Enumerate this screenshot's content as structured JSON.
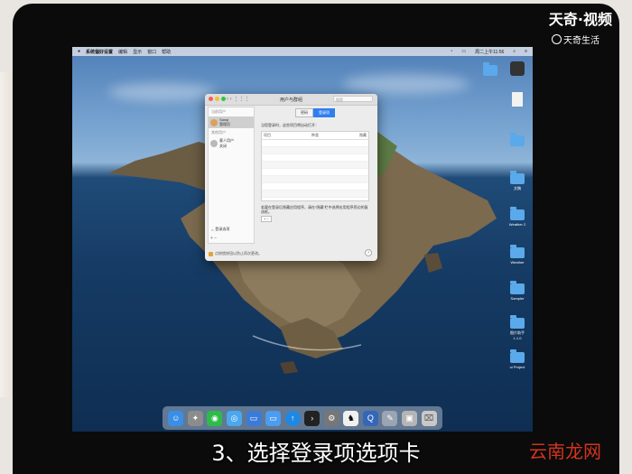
{
  "menubar": {
    "apple": "",
    "app": "系统偏好设置",
    "items": [
      "编辑",
      "显示",
      "窗口",
      "帮助"
    ],
    "clock": "周二上午11:56"
  },
  "desktop_icons": [
    "",
    "",
    "",
    "文稿",
    "Weather 2",
    "Weather",
    "Sampler",
    "图片助手1.1.0",
    "ui Project"
  ],
  "window": {
    "title": "用户与群组",
    "nav": "‹ › ⋮⋮⋮",
    "search_placeholder": "搜索",
    "sidebar": {
      "header_current": "当前用户",
      "user_name": "Sanqi",
      "user_role": "管理员",
      "header_other": "其他用户",
      "guest_name": "客人用户",
      "guest_status": "关闭",
      "login_options": "登录选项",
      "add_remove": "+ −"
    },
    "tabs": [
      "密码",
      "登录项"
    ],
    "active_tab": 1,
    "hint": "当您登录时，这些项目将自动打开：",
    "table_headers": [
      "项目",
      "种类",
      "隐藏"
    ],
    "note": "若要在登录后隐藏应用程序，请在“隐藏”栏中选择应用程序旁边的复选框。",
    "plusminus": "+ −",
    "lock_text": "点按锁按钮以防止再次更改。",
    "help": "?"
  },
  "subtitle": "3、选择登录项选项卡",
  "watermark": {
    "top": "天奇·视频",
    "top_sub": "天奇生活",
    "bottom": "云南龙网"
  },
  "colors": {
    "accent": "#2f7ff0",
    "watermark_red": "#d3341c"
  }
}
